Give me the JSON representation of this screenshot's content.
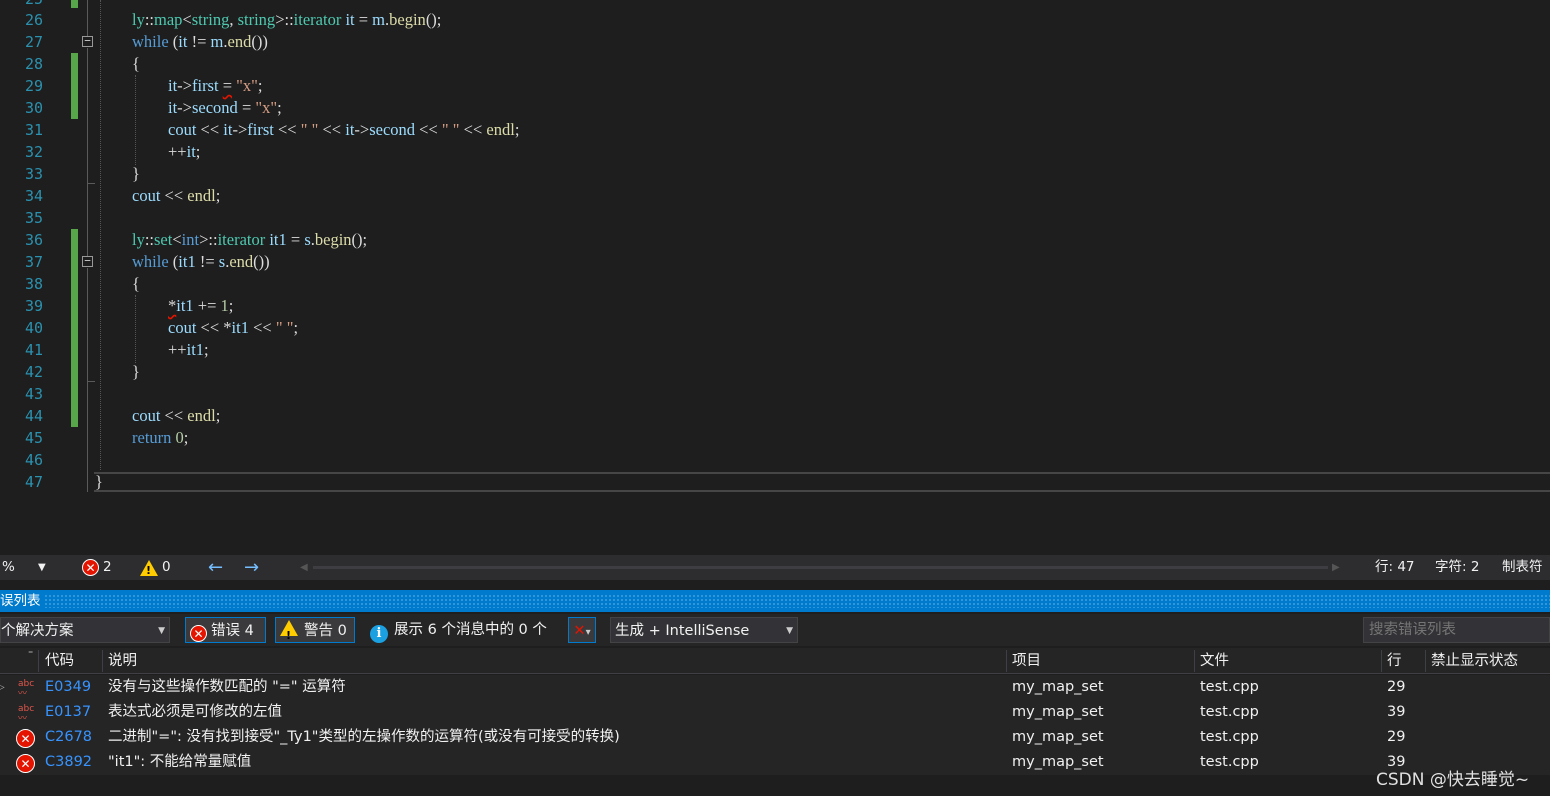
{
  "editor": {
    "lines": [
      {
        "n": "26",
        "code": "ly::map<string, string>::iterator it = m.begin();"
      },
      {
        "n": "27",
        "code": "while (it != m.end())"
      },
      {
        "n": "28",
        "code": "{"
      },
      {
        "n": "29",
        "code": "it->first = \"x\";"
      },
      {
        "n": "30",
        "code": "it->second = \"x\";"
      },
      {
        "n": "31",
        "code": "cout << it->first << \" \" << it->second << \" \" << endl;"
      },
      {
        "n": "32",
        "code": "++it;"
      },
      {
        "n": "33",
        "code": "}"
      },
      {
        "n": "34",
        "code": "cout << endl;"
      },
      {
        "n": "35",
        "code": ""
      },
      {
        "n": "36",
        "code": "ly::set<int>::iterator it1 = s.begin();"
      },
      {
        "n": "37",
        "code": "while (it1 != s.end())"
      },
      {
        "n": "38",
        "code": "{"
      },
      {
        "n": "39",
        "code": "*it1 += 1;"
      },
      {
        "n": "40",
        "code": "cout << *it1 << \" \";"
      },
      {
        "n": "41",
        "code": "++it1;"
      },
      {
        "n": "42",
        "code": "}"
      },
      {
        "n": "43",
        "code": ""
      },
      {
        "n": "44",
        "code": "cout << endl;"
      },
      {
        "n": "45",
        "code": "return 0;"
      },
      {
        "n": "46",
        "code": ""
      },
      {
        "n": "47",
        "code": "}"
      }
    ]
  },
  "statusbar": {
    "zoom": "%",
    "errors": "2",
    "warnings": "0",
    "line": "行: 47",
    "char": "字符: 2",
    "tab": "制表符"
  },
  "error_list": {
    "title": "误列表",
    "scope": "个解决方案",
    "errors_btn": "错误 4",
    "warnings_btn": "警告 0",
    "messages_btn": "展示 6 个消息中的 0 个",
    "build_filter": "生成 + IntelliSense",
    "search_placeholder": "搜索错误列表",
    "columns": {
      "code": "代码",
      "desc": "说明",
      "project": "项目",
      "file": "文件",
      "line": "行",
      "suppress": "禁止显示状态"
    },
    "rows": [
      {
        "icon": "abc",
        "code": "E0349",
        "desc": "没有与这些操作数匹配的 \"=\" 运算符",
        "project": "my_map_set",
        "file": "test.cpp",
        "line": "29"
      },
      {
        "icon": "abc",
        "code": "E0137",
        "desc": "表达式必须是可修改的左值",
        "project": "my_map_set",
        "file": "test.cpp",
        "line": "39"
      },
      {
        "icon": "error",
        "code": "C2678",
        "desc": "二进制\"=\": 没有找到接受\"_Ty1\"类型的左操作数的运算符(或没有可接受的转换)",
        "project": "my_map_set",
        "file": "test.cpp",
        "line": "29"
      },
      {
        "icon": "error",
        "code": "C3892",
        "desc": "\"it1\": 不能给常量赋值",
        "project": "my_map_set",
        "file": "test.cpp",
        "line": "39"
      }
    ]
  },
  "watermark": "CSDN @快去睡觉~"
}
